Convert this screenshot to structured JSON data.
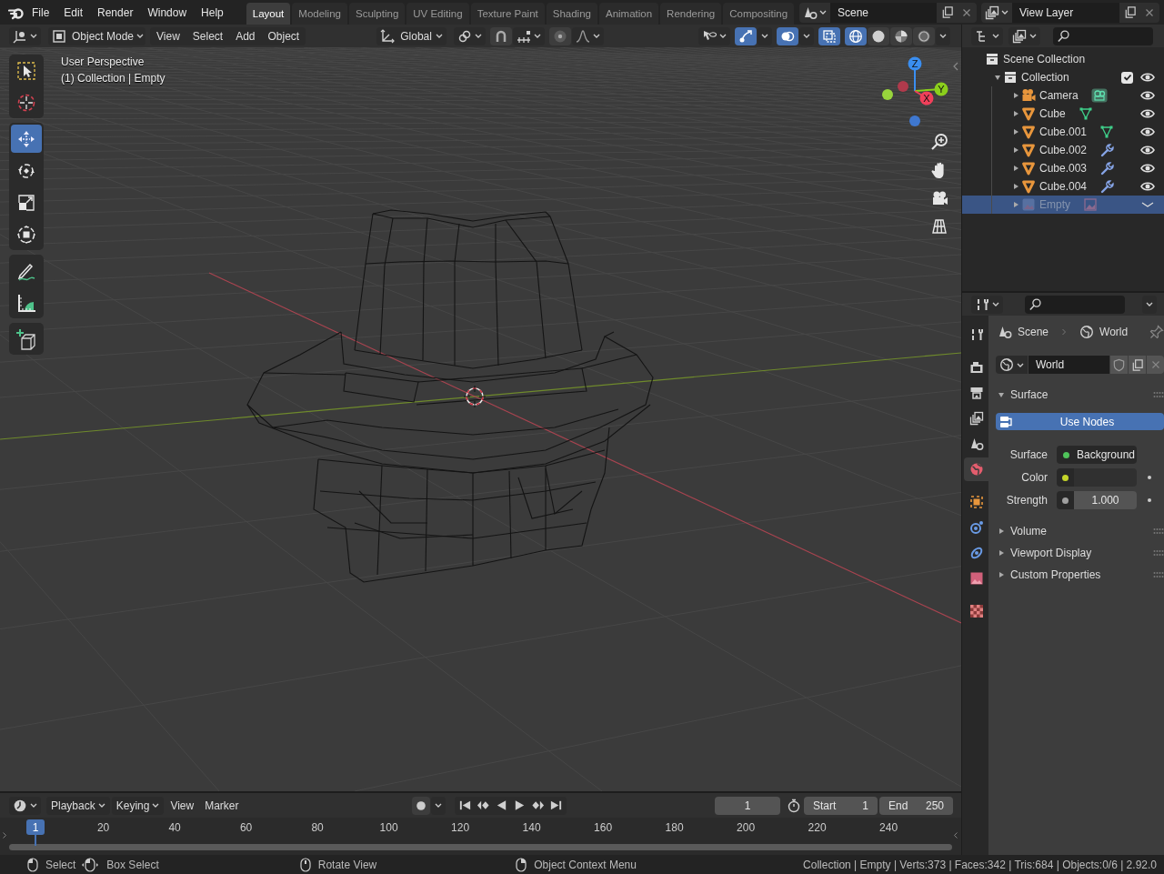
{
  "topbar": {
    "menus": [
      "File",
      "Edit",
      "Render",
      "Window",
      "Help"
    ],
    "workspaces": [
      {
        "label": "Layout",
        "selected": true
      },
      {
        "label": "Modeling",
        "selected": false
      },
      {
        "label": "Sculpting",
        "selected": false
      },
      {
        "label": "UV Editing",
        "selected": false
      },
      {
        "label": "Texture Paint",
        "selected": false
      },
      {
        "label": "Shading",
        "selected": false
      },
      {
        "label": "Animation",
        "selected": false
      },
      {
        "label": "Rendering",
        "selected": false
      },
      {
        "label": "Compositing",
        "selected": false
      }
    ],
    "scene": "Scene",
    "view_layer": "View Layer"
  },
  "viewport": {
    "mode": "Object Mode",
    "menus": [
      "View",
      "Select",
      "Add",
      "Object"
    ],
    "orientation": "Global",
    "toggles": [
      {
        "kind": "snap",
        "on": false
      },
      {
        "kind": "proportional",
        "on": false
      },
      {
        "kind": "gizmos",
        "on": true
      },
      {
        "kind": "overlays",
        "on": true
      },
      {
        "kind": "xray",
        "on": true
      }
    ],
    "shading": [
      {
        "kind": "wireframe",
        "selected": true
      },
      {
        "kind": "solid",
        "selected": false
      },
      {
        "kind": "material",
        "selected": false
      },
      {
        "kind": "rendered",
        "selected": false
      }
    ],
    "info": [
      "User Perspective",
      "(1) Collection | Empty"
    ],
    "tool_groups": [
      [
        {
          "kind": "select_box",
          "selected": false
        },
        {
          "kind": "cursor",
          "selected": false
        }
      ],
      [
        {
          "kind": "move",
          "selected": true
        },
        {
          "kind": "rotate",
          "selected": false
        },
        {
          "kind": "scale",
          "selected": false
        },
        {
          "kind": "transform",
          "selected": false
        }
      ],
      [
        {
          "kind": "annotate",
          "selected": false
        },
        {
          "kind": "measure",
          "selected": false
        }
      ],
      [
        {
          "kind": "add_cube",
          "selected": false
        }
      ]
    ],
    "gizmo_axes": [
      {
        "label": "Z",
        "kind": "z"
      },
      {
        "label": "Y",
        "kind": "y"
      },
      {
        "label": "X",
        "kind": "x"
      }
    ]
  },
  "outliner": {
    "tree": [
      {
        "label": "Scene Collection",
        "kind": "scene_collection",
        "selected": false,
        "children": [
          {
            "label": "Collection",
            "kind": "collection",
            "expanded": true,
            "checked": true,
            "selected": false,
            "children": [
              {
                "label": "Camera",
                "kind": "camera",
                "data": {
                  "kind": "camera"
                },
                "expanded": false,
                "selected": false,
                "disabled": false
              },
              {
                "label": "Cube",
                "kind": "mesh",
                "data": {
                  "kind": "mesh"
                },
                "expanded": false,
                "selected": false,
                "disabled": false
              },
              {
                "label": "Cube.001",
                "kind": "mesh",
                "data": {
                  "kind": "mesh"
                },
                "expanded": false,
                "selected": false,
                "disabled": false
              },
              {
                "label": "Cube.002",
                "kind": "mesh",
                "data": {
                  "kind": "modifier"
                },
                "expanded": false,
                "selected": false,
                "disabled": false
              },
              {
                "label": "Cube.003",
                "kind": "mesh",
                "data": {
                  "kind": "modifier"
                },
                "expanded": false,
                "selected": false,
                "disabled": false
              },
              {
                "label": "Cube.004",
                "kind": "mesh",
                "data": {
                  "kind": "modifier"
                },
                "expanded": false,
                "selected": false,
                "disabled": false
              },
              {
                "label": "Empty",
                "kind": "empty",
                "data": {
                  "kind": "image"
                },
                "expanded": false,
                "selected": true,
                "disabled": true
              }
            ]
          }
        ]
      }
    ]
  },
  "properties": {
    "tab_groups": [
      [
        {
          "kind": "tool",
          "selected": false
        }
      ],
      [
        {
          "kind": "render",
          "selected": false
        },
        {
          "kind": "output",
          "selected": false
        },
        {
          "kind": "view_layer",
          "selected": false
        },
        {
          "kind": "scene",
          "selected": false
        },
        {
          "kind": "world",
          "selected": true
        }
      ],
      [
        {
          "kind": "object",
          "selected": false
        },
        {
          "kind": "physics",
          "selected": false
        },
        {
          "kind": "constraints",
          "selected": false
        },
        {
          "kind": "empty_data",
          "selected": false
        }
      ],
      [
        {
          "kind": "texture",
          "selected": false
        }
      ]
    ],
    "breadcrumb": [
      "Scene",
      "World"
    ],
    "datablock": "World",
    "panels": [
      {
        "label": "Surface",
        "expanded": true,
        "button": "Use Nodes",
        "fields": [
          {
            "label": "Surface",
            "kind": "shader",
            "value": "Background",
            "color": "#4fc35a"
          },
          {
            "label": "Color",
            "kind": "color",
            "color": "#c4d52a"
          },
          {
            "label": "Strength",
            "kind": "number",
            "value": "1.000",
            "color": "#a0a0a0"
          }
        ]
      },
      {
        "label": "Volume",
        "expanded": false
      },
      {
        "label": "Viewport Display",
        "expanded": false
      },
      {
        "label": "Custom Properties",
        "expanded": false
      }
    ]
  },
  "timeline": {
    "menus": [
      {
        "label": "Playback",
        "kind": "dropdown"
      },
      {
        "label": "Keying",
        "kind": "dropdown"
      },
      {
        "label": "View",
        "kind": "menu"
      },
      {
        "label": "Marker",
        "kind": "menu"
      }
    ],
    "auto_keying": false,
    "current_frame": "1",
    "start_label": "Start",
    "start": "1",
    "end_label": "End",
    "end": "250",
    "playhead": "1",
    "ticks": [
      "20",
      "40",
      "60",
      "80",
      "100",
      "120",
      "140",
      "160",
      "180",
      "200",
      "220",
      "240"
    ]
  },
  "status_bar": {
    "hints": [
      {
        "label": "Select",
        "kind": "left_click"
      },
      {
        "label": "Box Select",
        "kind": "drag"
      },
      {
        "label": "Rotate View",
        "kind": "middle"
      },
      {
        "label": "Object Context Menu",
        "kind": "right_click"
      }
    ],
    "stats": "Collection | Empty | Verts:373 | Faces:342 | Tris:684 | Objects:0/6 | 2.92.0"
  }
}
